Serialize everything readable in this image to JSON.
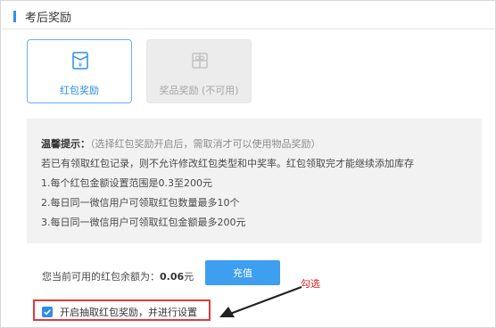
{
  "section": {
    "title": "考后奖励"
  },
  "reward_options": {
    "red_packet": {
      "label": "红包奖励",
      "icon": "red-envelope-icon",
      "selected": true
    },
    "prize": {
      "label": "奖品奖励 (不可用)",
      "icon": "gift-icon",
      "disabled": true
    }
  },
  "tips": {
    "heading": "温馨提示：",
    "heading_note": "（选择红包奖励开启后，需取消才可以使用物品奖励）",
    "line1": "若已有领取红包记录，则不允许修改红包类型和中奖率。红包领取完才能继续添加库存",
    "line2": "1.每个红包金额设置范围是0.3至200元",
    "line3": "2.每日同一微信用户可领取红包数量最多10个",
    "line4": "3.每日同一微信用户可领取红包金额最多200元"
  },
  "balance": {
    "label": "您当前可用的红包余额为：",
    "amount": "0.06",
    "unit": "元"
  },
  "recharge_label": "充值",
  "checkbox": {
    "label": "开启抽取红包奖励，并进行设置",
    "checked": true
  },
  "annotation": {
    "text": "勾选",
    "color": "#e02020"
  },
  "colors": {
    "accent": "#3e9ef0",
    "annotation_red": "#e23a3a"
  }
}
